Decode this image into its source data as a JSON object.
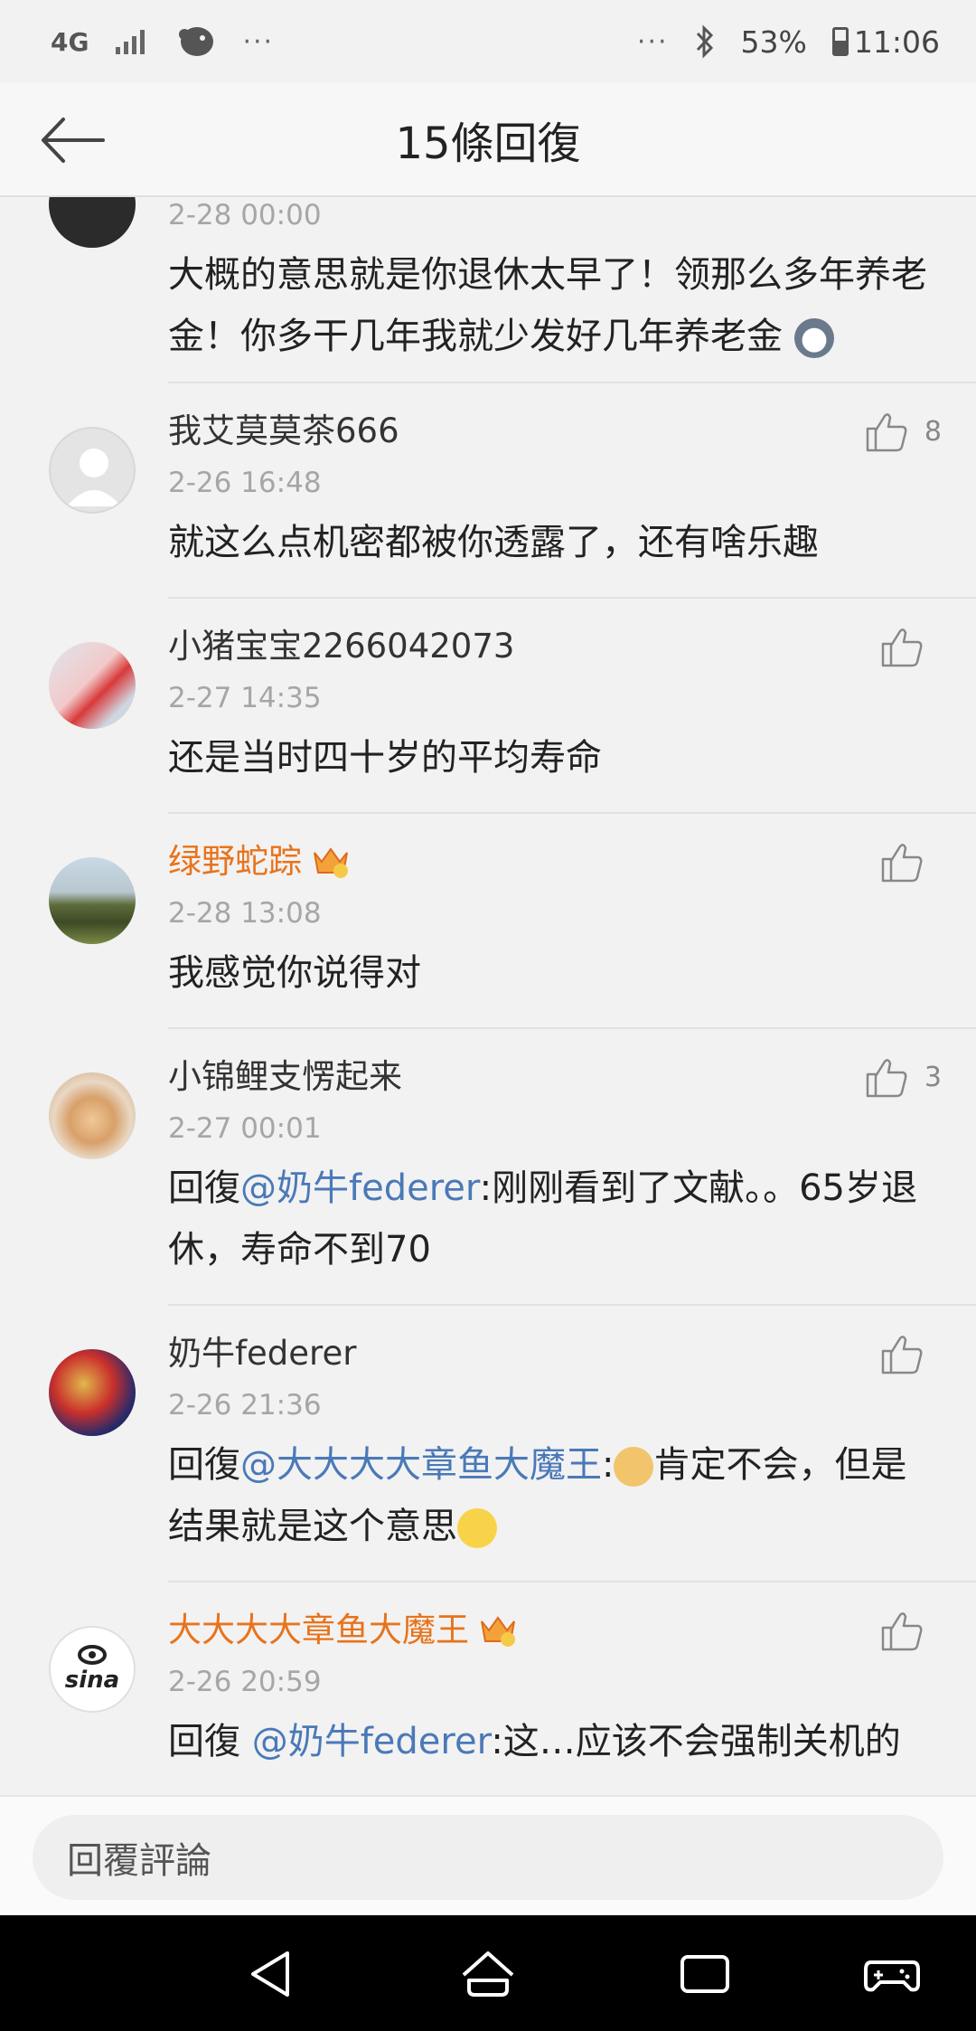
{
  "status_bar": {
    "network": "4G",
    "dots_left": "···",
    "dots_right": "···",
    "battery": "53%",
    "time": "11:06"
  },
  "header": {
    "title": "15條回復"
  },
  "comments": [
    {
      "name": "",
      "time": "2-28 00:00",
      "text": "大概的意思就是你退休太早了！领那么多年养老金！你多干几年我就少发好几年养老金"
    },
    {
      "name": "我艾莫莫茶666",
      "time": "2-26 16:48",
      "text": "就这么点机密都被你透露了，还有啥乐趣",
      "likes": "8"
    },
    {
      "name": "小猪宝宝2266042073",
      "time": "2-27 14:35",
      "text": "还是当时四十岁的平均寿命"
    },
    {
      "name": "绿野蛇踪",
      "time": "2-28 13:08",
      "text": "我感觉你说得对"
    },
    {
      "name": "小锦鲤支愣起来",
      "time": "2-27 00:01",
      "reply_prefix": "回復",
      "mention": "@奶牛federer",
      "text": ":刚刚看到了文献。。65岁退休，寿命不到70",
      "likes": "3"
    },
    {
      "name": "奶牛federer",
      "time": "2-26 21:36",
      "reply_prefix": "回復",
      "mention": "@大大大大章鱼大魔王",
      "text_a": ":",
      "text_b": "肯定不会，但是结果就是这个意思"
    },
    {
      "name": "大大大大章鱼大魔王",
      "time": "2-26 20:59",
      "reply_prefix": "回復 ",
      "mention": "@奶牛federer",
      "text": ":这…应该不会强制关机的"
    }
  ],
  "input": {
    "placeholder": "回覆評論"
  },
  "colors": {
    "vip_name": "#e8731b",
    "mention": "#4a79b8",
    "time": "#a6a6a6"
  }
}
